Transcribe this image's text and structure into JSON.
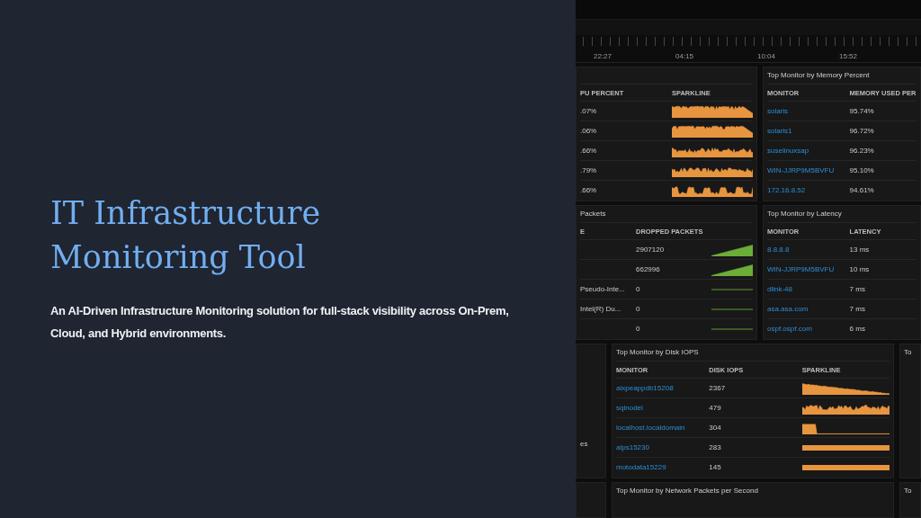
{
  "slide": {
    "title": "IT Infrastructure Monitoring Tool",
    "subtitle": "An AI-Driven Infrastructure Monitoring solution for full-stack visibility across On-Prem, Cloud, and Hybrid environments."
  },
  "dashboard": {
    "timeline": {
      "labels": [
        "22:27",
        "04:15",
        "10:04",
        "15:52"
      ]
    },
    "panel_rows": [
      [
        {
          "columns": [
            "PU PERCENT",
            "SPARKLINE"
          ],
          "rows": [
            {
              "cells": [
                {
                  "kind": "text",
                  "text": ".07%"
                },
                {
                  "kind": "dense"
                }
              ]
            },
            {
              "cells": [
                {
                  "kind": "text",
                  "text": ".06%"
                },
                {
                  "kind": "dense"
                }
              ]
            },
            {
              "cells": [
                {
                  "kind": "text",
                  "text": ".66%"
                },
                {
                  "kind": "noisy"
                }
              ]
            },
            {
              "cells": [
                {
                  "kind": "text",
                  "text": ".79%"
                },
                {
                  "kind": "noisy"
                }
              ]
            },
            {
              "cells": [
                {
                  "kind": "text",
                  "text": ".66%"
                },
                {
                  "kind": "spiky"
                }
              ]
            }
          ]
        },
        {
          "title": "Top Monitor by Memory Percent",
          "columns": [
            "MONITOR",
            "MEMORY USED PER"
          ],
          "rows": [
            {
              "cells": [
                {
                  "kind": "link",
                  "text": "solaris"
                },
                {
                  "kind": "text",
                  "text": "95.74%"
                }
              ]
            },
            {
              "cells": [
                {
                  "kind": "link",
                  "text": "solaris1"
                },
                {
                  "kind": "text",
                  "text": "96.72%"
                }
              ]
            },
            {
              "cells": [
                {
                  "kind": "link",
                  "text": "suselinuxsap"
                },
                {
                  "kind": "text",
                  "text": "96.23%"
                }
              ]
            },
            {
              "cells": [
                {
                  "kind": "link",
                  "text": "WIN-JJRP9M5BVFU"
                },
                {
                  "kind": "text",
                  "text": "95.10%"
                }
              ]
            },
            {
              "cells": [
                {
                  "kind": "link",
                  "text": "172.16.8.52"
                },
                {
                  "kind": "text",
                  "text": "94.61%"
                }
              ]
            }
          ]
        }
      ],
      [
        {
          "title": "Packets",
          "columns": [
            "E",
            "DROPPED PACKETS"
          ],
          "rows": [
            {
              "cells": [
                {
                  "kind": "blank"
                },
                {
                  "kind": "text",
                  "text": "2907120"
                },
                {
                  "kind": "ramp"
                }
              ]
            },
            {
              "cells": [
                {
                  "kind": "blank"
                },
                {
                  "kind": "text",
                  "text": "662996"
                },
                {
                  "kind": "ramp"
                }
              ]
            },
            {
              "cells": [
                {
                  "kind": "text",
                  "text": "Pseudo-Inte..."
                },
                {
                  "kind": "text",
                  "text": "0"
                },
                {
                  "kind": "flat"
                }
              ]
            },
            {
              "cells": [
                {
                  "kind": "text",
                  "text": "Intel(R) Du..."
                },
                {
                  "kind": "text",
                  "text": "0"
                },
                {
                  "kind": "flat"
                }
              ]
            },
            {
              "cells": [
                {
                  "kind": "blank"
                },
                {
                  "kind": "text",
                  "text": "0"
                },
                {
                  "kind": "flat"
                }
              ]
            }
          ]
        },
        {
          "title": "Top Monitor by Latency",
          "columns": [
            "MONITOR",
            "LATENCY"
          ],
          "rows": [
            {
              "cells": [
                {
                  "kind": "link",
                  "text": "8.8.8.8"
                },
                {
                  "kind": "text",
                  "text": "13 ms"
                }
              ]
            },
            {
              "cells": [
                {
                  "kind": "link",
                  "text": "WIN-JJRP9M5BVFU"
                },
                {
                  "kind": "text",
                  "text": "10 ms"
                }
              ]
            },
            {
              "cells": [
                {
                  "kind": "link",
                  "text": "dlink-48"
                },
                {
                  "kind": "text",
                  "text": "7 ms"
                }
              ]
            },
            {
              "cells": [
                {
                  "kind": "link",
                  "text": "asa.asa.com"
                },
                {
                  "kind": "text",
                  "text": "7 ms"
                }
              ]
            },
            {
              "cells": [
                {
                  "kind": "link",
                  "text": "ospf.ospf.com"
                },
                {
                  "kind": "text",
                  "text": "6 ms"
                }
              ]
            }
          ]
        }
      ],
      [
        {
          "note": "es"
        },
        {
          "title": "Top Monitor by Disk IOPS",
          "columns": [
            "MONITOR",
            "DISK IOPS",
            "SPARKLINE"
          ],
          "rows": [
            {
              "cells": [
                {
                  "kind": "link",
                  "text": "aixpeappdb15208"
                },
                {
                  "kind": "text",
                  "text": "2367"
                },
                {
                  "kind": "decline"
                }
              ]
            },
            {
              "cells": [
                {
                  "kind": "link",
                  "text": "sqlnodel"
                },
                {
                  "kind": "text",
                  "text": "479"
                },
                {
                  "kind": "noisy"
                }
              ]
            },
            {
              "cells": [
                {
                  "kind": "link",
                  "text": "localhost.localdomain"
                },
                {
                  "kind": "text",
                  "text": "304"
                },
                {
                  "kind": "step"
                }
              ]
            },
            {
              "cells": [
                {
                  "kind": "link",
                  "text": "aips15230"
                },
                {
                  "kind": "text",
                  "text": "283"
                },
                {
                  "kind": "band"
                }
              ]
            },
            {
              "cells": [
                {
                  "kind": "link",
                  "text": "motodata15229"
                },
                {
                  "kind": "text",
                  "text": "145"
                },
                {
                  "kind": "band"
                }
              ]
            }
          ]
        },
        {
          "title": "To"
        }
      ],
      [
        {},
        {
          "title": "Top Monitor by Network Packets per Second"
        },
        {
          "title": "To"
        }
      ]
    ]
  }
}
